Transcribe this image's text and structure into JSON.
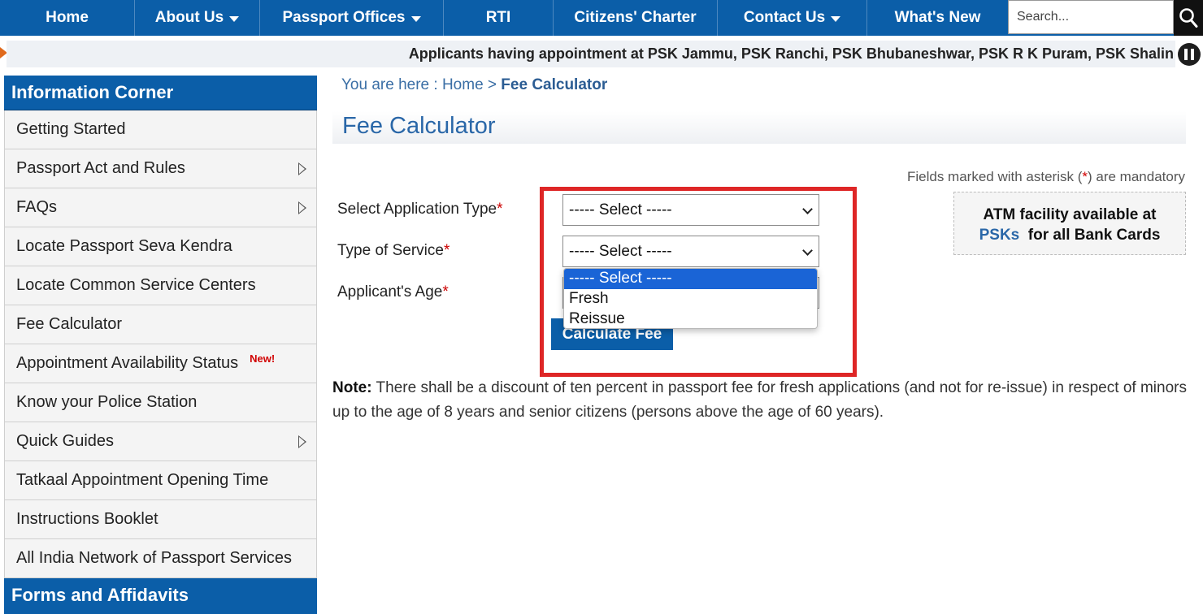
{
  "nav": {
    "items": [
      {
        "label": "Home",
        "has_caret": false
      },
      {
        "label": "About Us",
        "has_caret": true
      },
      {
        "label": "Passport Offices",
        "has_caret": true
      },
      {
        "label": "RTI",
        "has_caret": false
      },
      {
        "label": "Citizens' Charter",
        "has_caret": false
      },
      {
        "label": "Contact Us",
        "has_caret": true
      },
      {
        "label": "What's New",
        "has_caret": false
      }
    ],
    "search_placeholder": "Search...",
    "search_icon": "search-icon",
    "bg_color": "#0b5ea8"
  },
  "ticker": {
    "text": "Applicants having appointment at PSK Jammu, PSK Ranchi, PSK Bhubaneshwar, PSK R K Puram, PSK Shalin",
    "pause_icon": "pause-icon"
  },
  "sidebar": {
    "heading": "Information Corner",
    "items": [
      {
        "label": "Getting Started",
        "submenu": false
      },
      {
        "label": "Passport Act and Rules",
        "submenu": true
      },
      {
        "label": "FAQs",
        "submenu": true
      },
      {
        "label": "Locate Passport Seva Kendra",
        "submenu": false
      },
      {
        "label": "Locate Common Service Centers",
        "submenu": false
      },
      {
        "label": "Fee Calculator",
        "submenu": false
      },
      {
        "label": "Appointment Availability Status",
        "submenu": false,
        "badge": "New!"
      },
      {
        "label": "Know your Police Station",
        "submenu": false
      },
      {
        "label": "Quick Guides",
        "submenu": true
      },
      {
        "label": "Tatkaal Appointment Opening Time",
        "submenu": false
      },
      {
        "label": "Instructions Booklet",
        "submenu": false
      },
      {
        "label": "All India Network of Passport Services",
        "submenu": false
      }
    ],
    "heading2": "Forms and Affidavits"
  },
  "breadcrumb": {
    "prefix": "You are here : ",
    "home": "Home",
    "separator": " > ",
    "current": "Fee Calculator"
  },
  "page": {
    "title": "Fee Calculator",
    "mandatory_prefix": "Fields marked with asterisk (",
    "mandatory_star": "*",
    "mandatory_suffix": ") are mandatory"
  },
  "form": {
    "application_type_label": "Select Application Type",
    "application_type_value": "----- Select -----",
    "service_type_label": "Type of Service",
    "service_type_value": "----- Select -----",
    "age_label": "Applicant's Age",
    "required_marker": "*",
    "calculate_button": "Calculate Fee",
    "dropdown_options": [
      "----- Select -----",
      "Fresh",
      "Reissue"
    ],
    "dropdown_selected_index": 0
  },
  "atm": {
    "line1": "ATM facility available at",
    "psks": "PSKs",
    "line2_rest": "  for all Bank Cards"
  },
  "note": {
    "label": "Note:",
    "text": " There shall be a discount of ten percent in passport fee for fresh applications (and not for re-issue) in respect of minors up to the age of 8 years and senior citizens (persons above the age of 60 years)."
  },
  "colors": {
    "primary": "#0b5ea8",
    "highlight": "#de2626",
    "required": "#cc0000",
    "dropdown_selected": "#1a64d6"
  }
}
